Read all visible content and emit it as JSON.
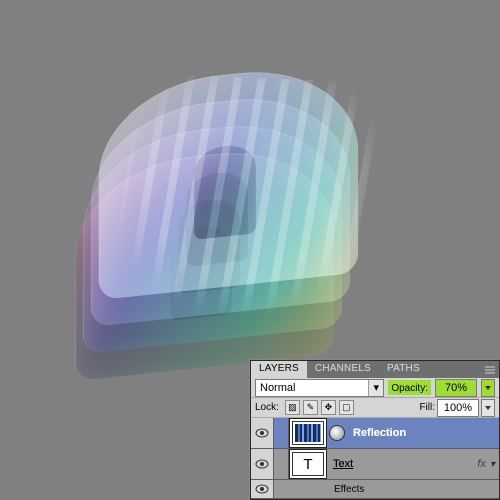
{
  "panel": {
    "tabs": {
      "layers": "LAYERS",
      "channels": "CHANNELS",
      "paths": "PATHS"
    },
    "blend_mode": "Normal",
    "opacity": {
      "label": "Opacity:",
      "value": "70%"
    },
    "lock_label": "Lock:",
    "fill": {
      "label": "Fill:",
      "value": "100%"
    },
    "items": [
      {
        "name": "Reflection",
        "selected": true,
        "has_mask": true,
        "thumb": "reflection"
      },
      {
        "name": "Text",
        "selected": false,
        "thumb": "T",
        "fx": true
      }
    ],
    "effects_label": "Effects",
    "fx_label": "fx",
    "reveal_symbol": "▾",
    "dd_symbol": "▾"
  },
  "icons": {
    "lock_trans": "▨",
    "lock_paint": "✎",
    "lock_move": "✥",
    "lock_all": "▢"
  }
}
